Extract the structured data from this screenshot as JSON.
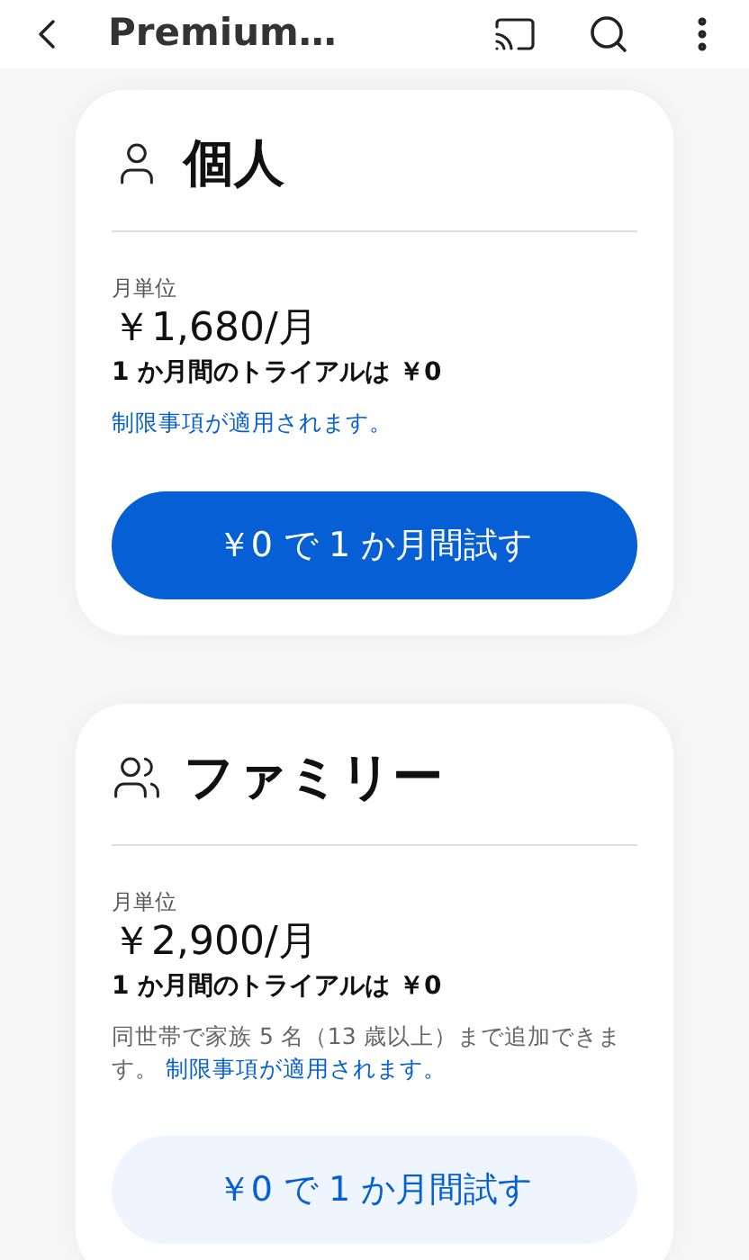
{
  "app_bar": {
    "title": "Premium…"
  },
  "plans": [
    {
      "kind": "person",
      "name": "個人",
      "period": "月単位",
      "price": "￥1,680/月",
      "trial": "1 か月間のトライアルは ￥0",
      "link": "制限事項が適用されます。",
      "button": {
        "label": "￥0 で 1 か月間試す",
        "kind": "primary"
      }
    },
    {
      "kind": "family",
      "name": "ファミリー",
      "period": "月単位",
      "price": "￥2,900/月",
      "trial": "1 か月間のトライアルは ￥0",
      "note": "同世帯で家族 5 名（13 歳以上）まで追加できます。",
      "link": "制限事項が適用されます。",
      "button": {
        "label": "￥0 で 1 か月間試す",
        "kind": "secondary"
      }
    }
  ]
}
